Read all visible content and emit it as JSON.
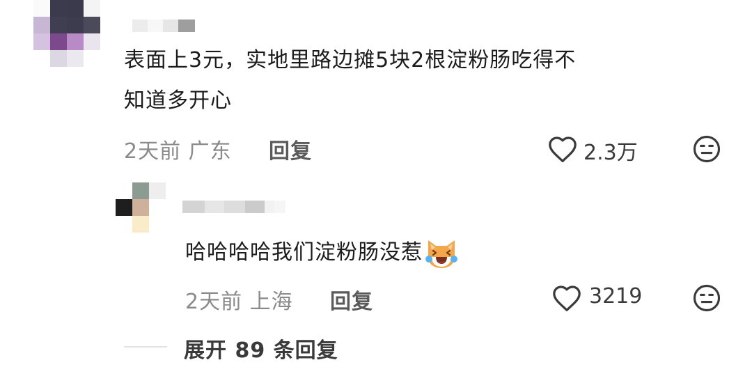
{
  "comment": {
    "text_line1": "表面上3元，实地里路边摊5块2根淀粉肠吃得不",
    "text_line2": "知道多开心",
    "meta": "2天前 广东",
    "reply_label": "回复",
    "likes": "2.3万",
    "icons": {
      "like": "heart-outline-icon",
      "dislike": "meh-face-icon"
    }
  },
  "reply": {
    "text": "哈哈哈哈我们淀粉肠没惹",
    "emoji": "crying-laughing-cat-emoji",
    "meta": "2天前 上海",
    "reply_label": "回复",
    "likes": "3219"
  },
  "expand": {
    "label": "展开 89 条回复"
  },
  "colors": {
    "text": "#1b1b1b",
    "meta": "#8a8a8a",
    "icon": "#3a3a3a",
    "background": "#ffffff"
  }
}
